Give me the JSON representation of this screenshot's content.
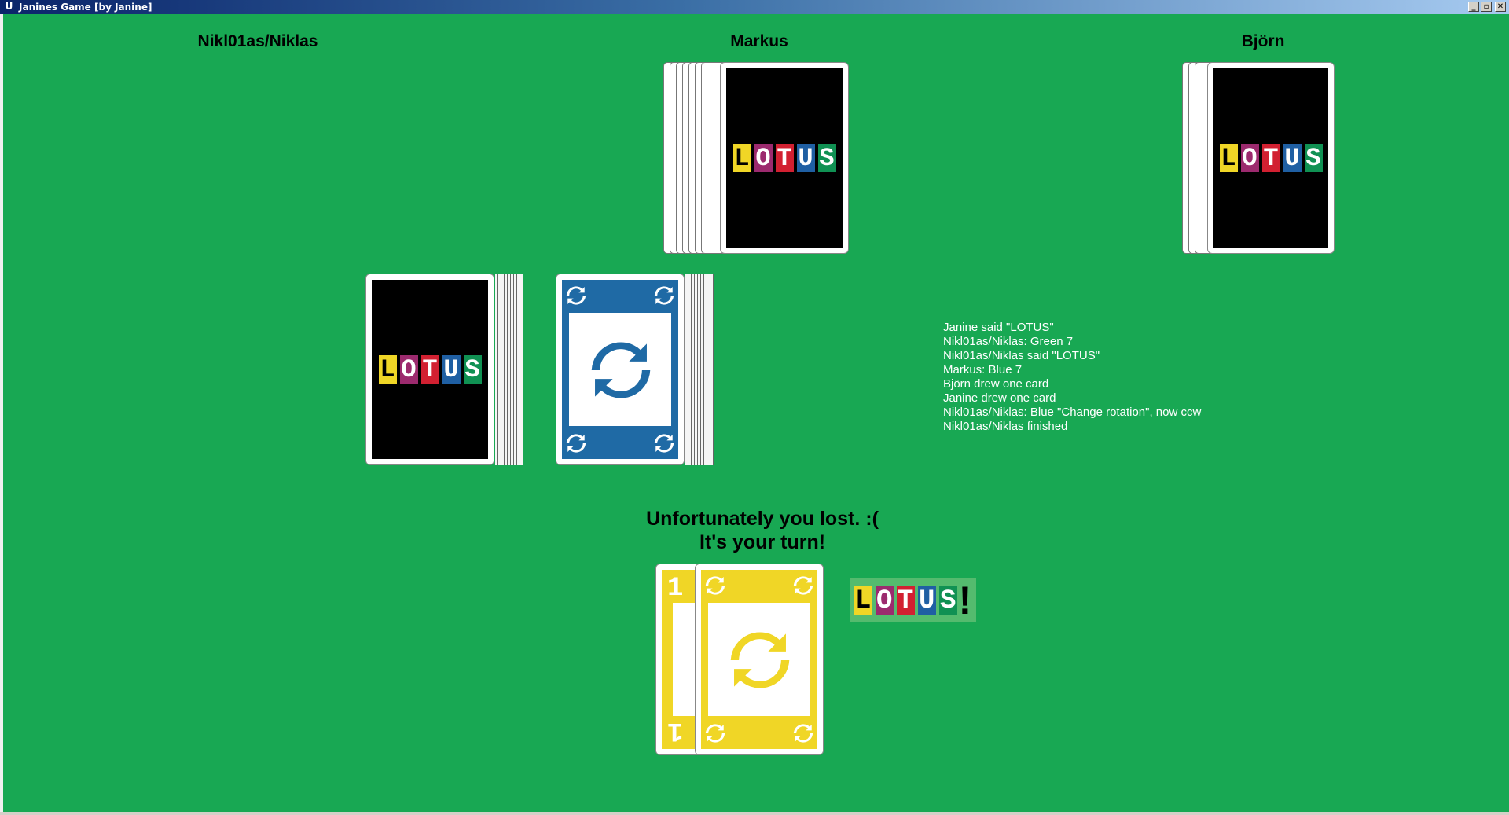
{
  "window": {
    "title": "Janines Game [by Janine]",
    "app_icon": "U",
    "controls": [
      {
        "name": "minimize-button",
        "glyph": "_"
      },
      {
        "name": "maximize-button",
        "glyph": "▫"
      },
      {
        "name": "close-button",
        "glyph": "✕"
      }
    ]
  },
  "colors": {
    "table": "#18a853",
    "card_blue": "#1f6aa5",
    "card_yellow": "#f0d626",
    "logo_letters": [
      "#f0d626",
      "#9c2a6e",
      "#d22031",
      "#1f5fa3",
      "#109153"
    ]
  },
  "logo_text": [
    "L",
    "O",
    "T",
    "U",
    "S"
  ],
  "players": {
    "left": {
      "name": "Nikl01as/Niklas"
    },
    "top": {
      "name": "Markus"
    },
    "right": {
      "name": "Björn"
    }
  },
  "piles": {
    "draw_pile": {
      "face": "card-back"
    },
    "discard_pile": {
      "color": "blue",
      "symbol": "rotation-icon"
    }
  },
  "log": [
    "Janine said \"LOTUS\"",
    "Nikl01as/Niklas: Green 7",
    "Nikl01as/Niklas said \"LOTUS\"",
    "Markus: Blue 7",
    "Björn drew one card",
    "Janine drew one card",
    "Nikl01as/Niklas: Blue \"Change rotation\", now ccw",
    "Nikl01as/Niklas finished"
  ],
  "status": {
    "line1": "Unfortunately you lost. :(",
    "line2": "It's your turn!"
  },
  "hand": {
    "cards": [
      {
        "color": "yellow",
        "value": "1"
      },
      {
        "color": "yellow",
        "symbol": "rotation-icon"
      }
    ]
  },
  "lotus_button": {
    "letters": [
      "L",
      "O",
      "T",
      "U",
      "S"
    ],
    "suffix": "!"
  }
}
